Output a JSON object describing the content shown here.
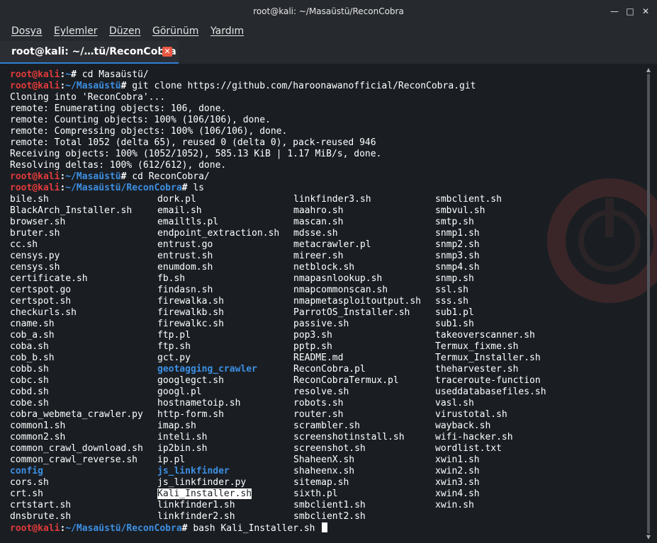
{
  "window": {
    "title": "root@kali: ~/Masaüstü/ReconCobra",
    "controls": {
      "minimize": "—",
      "maximize": "□",
      "close": "✕"
    }
  },
  "menu": [
    "Dosya",
    "Eylemler",
    "Düzen",
    "Görünüm",
    "Yardım"
  ],
  "tab": {
    "label": "root@kali: ~/…tü/ReconCobra",
    "close": "✕"
  },
  "prompt": {
    "user": "root@kali"
  },
  "header_lines": [
    {
      "type": "prompt",
      "path": "~",
      "command": "cd Masaüstü/"
    },
    {
      "type": "prompt",
      "path": "~/Masaüstü",
      "command": "git clone https://github.com/haroonawanofficial/ReconCobra.git"
    },
    {
      "type": "output",
      "text": "Cloning into 'ReconCobra'..."
    },
    {
      "type": "output",
      "text": "remote: Enumerating objects: 106, done."
    },
    {
      "type": "output",
      "text": "remote: Counting objects: 100% (106/106), done."
    },
    {
      "type": "output",
      "text": "remote: Compressing objects: 100% (106/106), done."
    },
    {
      "type": "output",
      "text": "remote: Total 1052 (delta 65), reused 0 (delta 0), pack-reused 946"
    },
    {
      "type": "output",
      "text": "Receiving objects: 100% (1052/1052), 585.13 KiB | 1.17 MiB/s, done."
    },
    {
      "type": "output",
      "text": "Resolving deltas: 100% (612/612), done."
    },
    {
      "type": "prompt",
      "path": "~/Masaüstü",
      "command": "cd ReconCobra/"
    },
    {
      "type": "prompt",
      "path": "~/Masaüstü/ReconCobra",
      "command": "ls"
    }
  ],
  "ls_columns": [
    [
      {
        "name": "bile.sh"
      },
      {
        "name": "BlackArch_Installer.sh"
      },
      {
        "name": "browser.sh"
      },
      {
        "name": "bruter.sh"
      },
      {
        "name": "cc.sh"
      },
      {
        "name": "censys.py"
      },
      {
        "name": "censys.sh"
      },
      {
        "name": "certificate.sh"
      },
      {
        "name": "certspot.go"
      },
      {
        "name": "certspot.sh"
      },
      {
        "name": "checkurls.sh"
      },
      {
        "name": "cname.sh"
      },
      {
        "name": "cob_a.sh"
      },
      {
        "name": "coba.sh"
      },
      {
        "name": "cob_b.sh"
      },
      {
        "name": "cobb.sh"
      },
      {
        "name": "cobc.sh"
      },
      {
        "name": "cobd.sh"
      },
      {
        "name": "cobe.sh"
      },
      {
        "name": "cobra_webmeta_crawler.py"
      },
      {
        "name": "common1.sh"
      },
      {
        "name": "common2.sh"
      },
      {
        "name": "common_crawl_download.sh"
      },
      {
        "name": "common_crawl_reverse.sh"
      },
      {
        "name": "config",
        "kind": "dir"
      },
      {
        "name": "cors.sh"
      },
      {
        "name": "crt.sh"
      },
      {
        "name": "crtstart.sh"
      },
      {
        "name": "dnsbrute.sh"
      }
    ],
    [
      {
        "name": "dork.pl"
      },
      {
        "name": "email.sh"
      },
      {
        "name": "emailtls.pl"
      },
      {
        "name": "endpoint_extraction.sh"
      },
      {
        "name": "entrust.go"
      },
      {
        "name": "entrust.sh"
      },
      {
        "name": "enumdom.sh"
      },
      {
        "name": "fb.sh"
      },
      {
        "name": "findasn.sh"
      },
      {
        "name": "firewalka.sh"
      },
      {
        "name": "firewalkb.sh"
      },
      {
        "name": "firewalkc.sh"
      },
      {
        "name": "ftp.pl"
      },
      {
        "name": "ftp.sh"
      },
      {
        "name": "gct.py"
      },
      {
        "name": "geotagging_crawler",
        "kind": "dir"
      },
      {
        "name": "googlegct.sh"
      },
      {
        "name": "googl.pl"
      },
      {
        "name": "hostnametoip.sh"
      },
      {
        "name": "http-form.sh"
      },
      {
        "name": "imap.sh"
      },
      {
        "name": "inteli.sh"
      },
      {
        "name": "ip2bin.sh"
      },
      {
        "name": "ip.pl"
      },
      {
        "name": "js_linkfinder",
        "kind": "dir"
      },
      {
        "name": "js_linkfinder.py"
      },
      {
        "name": "Kali_Installer.sh",
        "kind": "selected"
      },
      {
        "name": "linkfinder1.sh"
      },
      {
        "name": "linkfinder2.sh"
      }
    ],
    [
      {
        "name": "linkfinder3.sh"
      },
      {
        "name": "maahro.sh"
      },
      {
        "name": "mascan.sh"
      },
      {
        "name": "mdsse.sh"
      },
      {
        "name": "metacrawler.pl"
      },
      {
        "name": "mireer.sh"
      },
      {
        "name": "netblock.sh"
      },
      {
        "name": "nmapasnlookup.sh"
      },
      {
        "name": "nmapcommonscan.sh"
      },
      {
        "name": "nmapmetasploitoutput.sh"
      },
      {
        "name": "ParrotOS_Installer.sh"
      },
      {
        "name": "passive.sh"
      },
      {
        "name": "pop3.sh"
      },
      {
        "name": "pptp.sh"
      },
      {
        "name": "README.md"
      },
      {
        "name": "ReconCobra.pl"
      },
      {
        "name": "ReconCobraTermux.pl"
      },
      {
        "name": "resolve.sh"
      },
      {
        "name": "robots.sh"
      },
      {
        "name": "router.sh"
      },
      {
        "name": "scrambler.sh"
      },
      {
        "name": "screenshotinstall.sh"
      },
      {
        "name": "screenshot.sh"
      },
      {
        "name": "ShaheenX.sh"
      },
      {
        "name": "shaheenx.sh"
      },
      {
        "name": "sitemap.sh"
      },
      {
        "name": "sixth.pl"
      },
      {
        "name": "smbclient1.sh"
      },
      {
        "name": "smbclient2.sh"
      }
    ],
    [
      {
        "name": "smbclient.sh"
      },
      {
        "name": "smbvul.sh"
      },
      {
        "name": "smtp.sh"
      },
      {
        "name": "snmp1.sh"
      },
      {
        "name": "snmp2.sh"
      },
      {
        "name": "snmp3.sh"
      },
      {
        "name": "snmp4.sh"
      },
      {
        "name": "snmp.sh"
      },
      {
        "name": "ssl.sh"
      },
      {
        "name": "sss.sh"
      },
      {
        "name": "sub1.pl"
      },
      {
        "name": "sub1.sh"
      },
      {
        "name": "takeoverscanner.sh"
      },
      {
        "name": "Termux_fixme.sh"
      },
      {
        "name": "Termux_Installer.sh"
      },
      {
        "name": "theharvester.sh"
      },
      {
        "name": "traceroute-function"
      },
      {
        "name": "useddatabasefiles.sh"
      },
      {
        "name": "vasl.sh"
      },
      {
        "name": "virustotal.sh"
      },
      {
        "name": "wayback.sh"
      },
      {
        "name": "wifi-hacker.sh"
      },
      {
        "name": "wordlist.txt"
      },
      {
        "name": "xwin1.sh"
      },
      {
        "name": "xwin2.sh"
      },
      {
        "name": "xwin3.sh"
      },
      {
        "name": "xwin4.sh"
      },
      {
        "name": "xwin.sh"
      }
    ]
  ],
  "final_prompt": {
    "path": "~/Masaüstü/ReconCobra",
    "command": "bash Kali_Installer.sh "
  },
  "colors": {
    "user": "#e23a3a",
    "path": "#3d8fe3",
    "tab_accent": "#2f7fd6",
    "background": "#1a1e23"
  }
}
